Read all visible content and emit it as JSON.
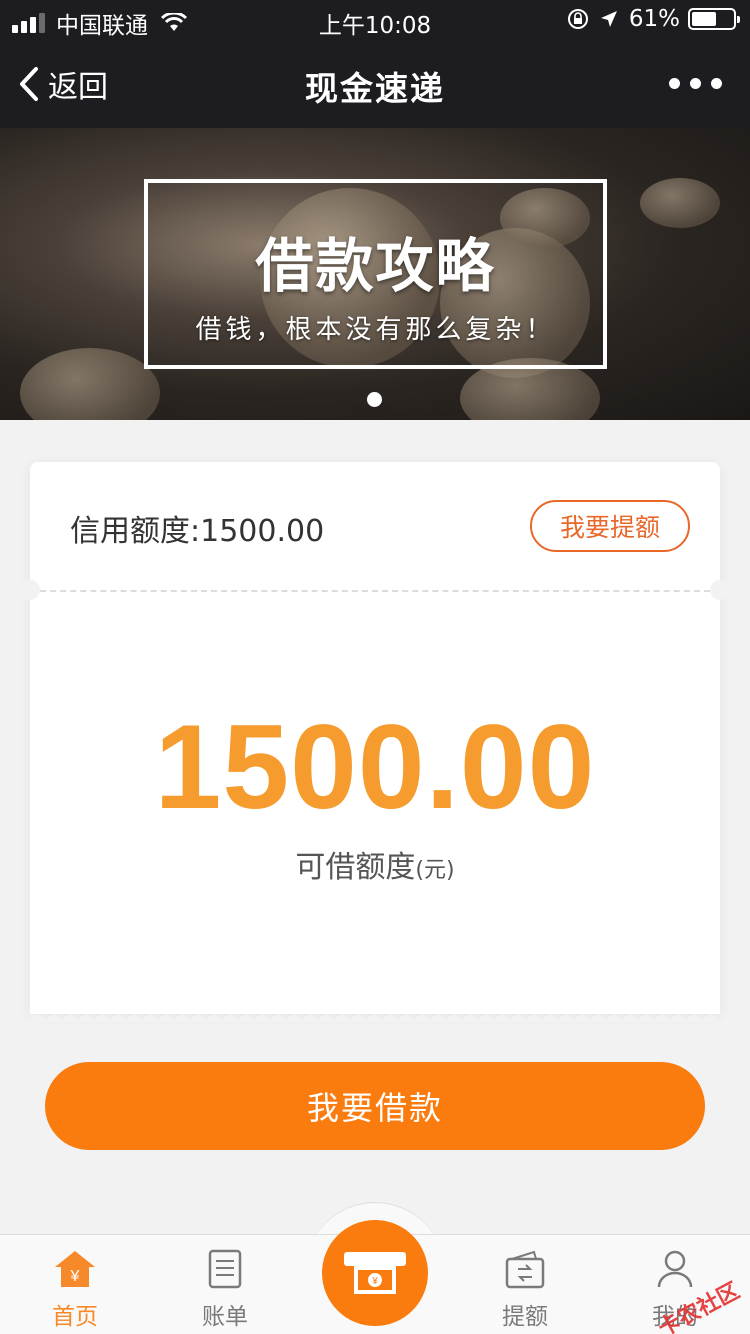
{
  "status_bar": {
    "carrier": "中国联通",
    "time": "上午10:08",
    "battery": "61%",
    "battery_level": 0.61
  },
  "nav": {
    "back_label": "返回",
    "title": "现金速递"
  },
  "banner": {
    "headline": "借款攻略",
    "subtitle": "借钱，根本没有那么复杂！"
  },
  "card": {
    "credit_label": "信用额度:1500.00",
    "raise_button": "我要提额",
    "available_amount": "1500.00",
    "available_label": "可借额度",
    "available_unit": "(元)"
  },
  "borrow_button": "我要借款",
  "tabbar": {
    "items": [
      {
        "label": "首页",
        "icon": "home-yen-icon"
      },
      {
        "label": "账单",
        "icon": "bill-icon"
      },
      {
        "label": "",
        "icon": "cash-atm-icon"
      },
      {
        "label": "提额",
        "icon": "wallet-icon"
      },
      {
        "label": "我的",
        "icon": "user-icon"
      }
    ]
  },
  "watermark": "卡农社区",
  "colors": {
    "accent": "#fa7b0e",
    "amount": "#f69c2f",
    "nav_bg": "#1c1c21",
    "tab_active": "#f68a2a"
  }
}
